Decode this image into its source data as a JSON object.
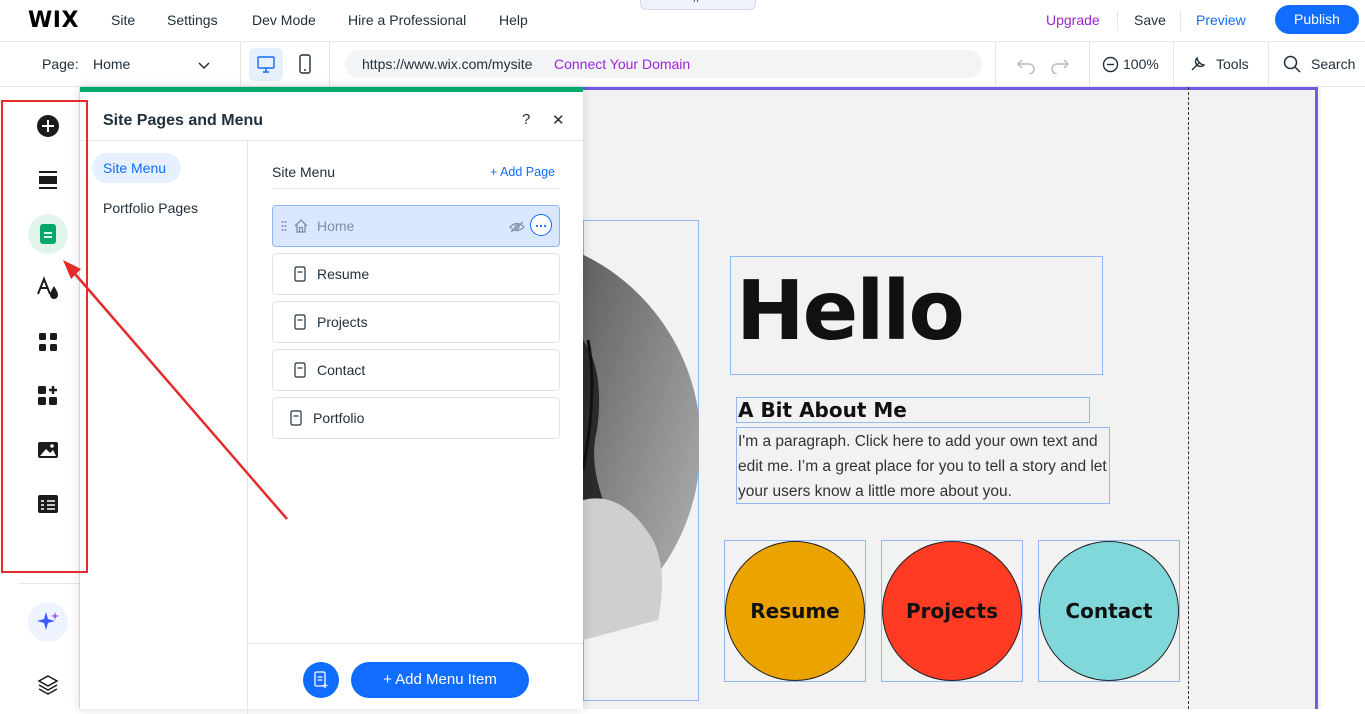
{
  "topbar": {
    "logo": "WIX",
    "menu": [
      "Site",
      "Settings",
      "Dev Mode",
      "Hire a Professional",
      "Help"
    ],
    "upgrade": "Upgrade",
    "save": "Save",
    "preview": "Preview",
    "publish": "Publish",
    "collapse_glyph": "˄"
  },
  "toolbar": {
    "page_label": "Page:",
    "page_value": "Home",
    "url": "https://www.wix.com/mysite",
    "connect_domain": "Connect Your Domain",
    "zoom": "100%",
    "tools": "Tools",
    "search": "Search"
  },
  "rail": {
    "icons": [
      "add-icon",
      "sections-icon",
      "pages-icon",
      "design-icon",
      "apps-icon",
      "business-apps-icon",
      "media-icon",
      "cms-icon"
    ],
    "active": "pages-icon",
    "bottom": [
      "ai-assistant-icon",
      "layers-icon"
    ]
  },
  "panel": {
    "title": "Site Pages and Menu",
    "help": "?",
    "close": "✕",
    "tabs": [
      "Site Menu",
      "Portfolio Pages"
    ],
    "section_title": "Site Menu",
    "add_page": "+ Add Page",
    "pages": [
      {
        "label": "Home",
        "type": "home",
        "selected": true
      },
      {
        "label": "Resume",
        "type": "page"
      },
      {
        "label": "Projects",
        "type": "page"
      },
      {
        "label": "Contact",
        "type": "page"
      },
      {
        "label": "Portfolio",
        "type": "page"
      }
    ],
    "add_menu_item": "+  Add Menu Item"
  },
  "site": {
    "heading": "Hello",
    "subheading": "A Bit About Me",
    "paragraph": "I'm a paragraph. Click here to add your own text and edit me. I’m a great place for you to tell a story and let your users know a little more about you.",
    "buttons": [
      {
        "label": "Resume",
        "color": "#eba300"
      },
      {
        "label": "Projects",
        "color": "#ff3b24"
      },
      {
        "label": "Contact",
        "color": "#80d8db"
      }
    ]
  },
  "colors": {
    "accent": "#116dff",
    "upgrade": "#9a27d5",
    "panel_top": "#00a86b",
    "annotation": "#e32b2b"
  }
}
